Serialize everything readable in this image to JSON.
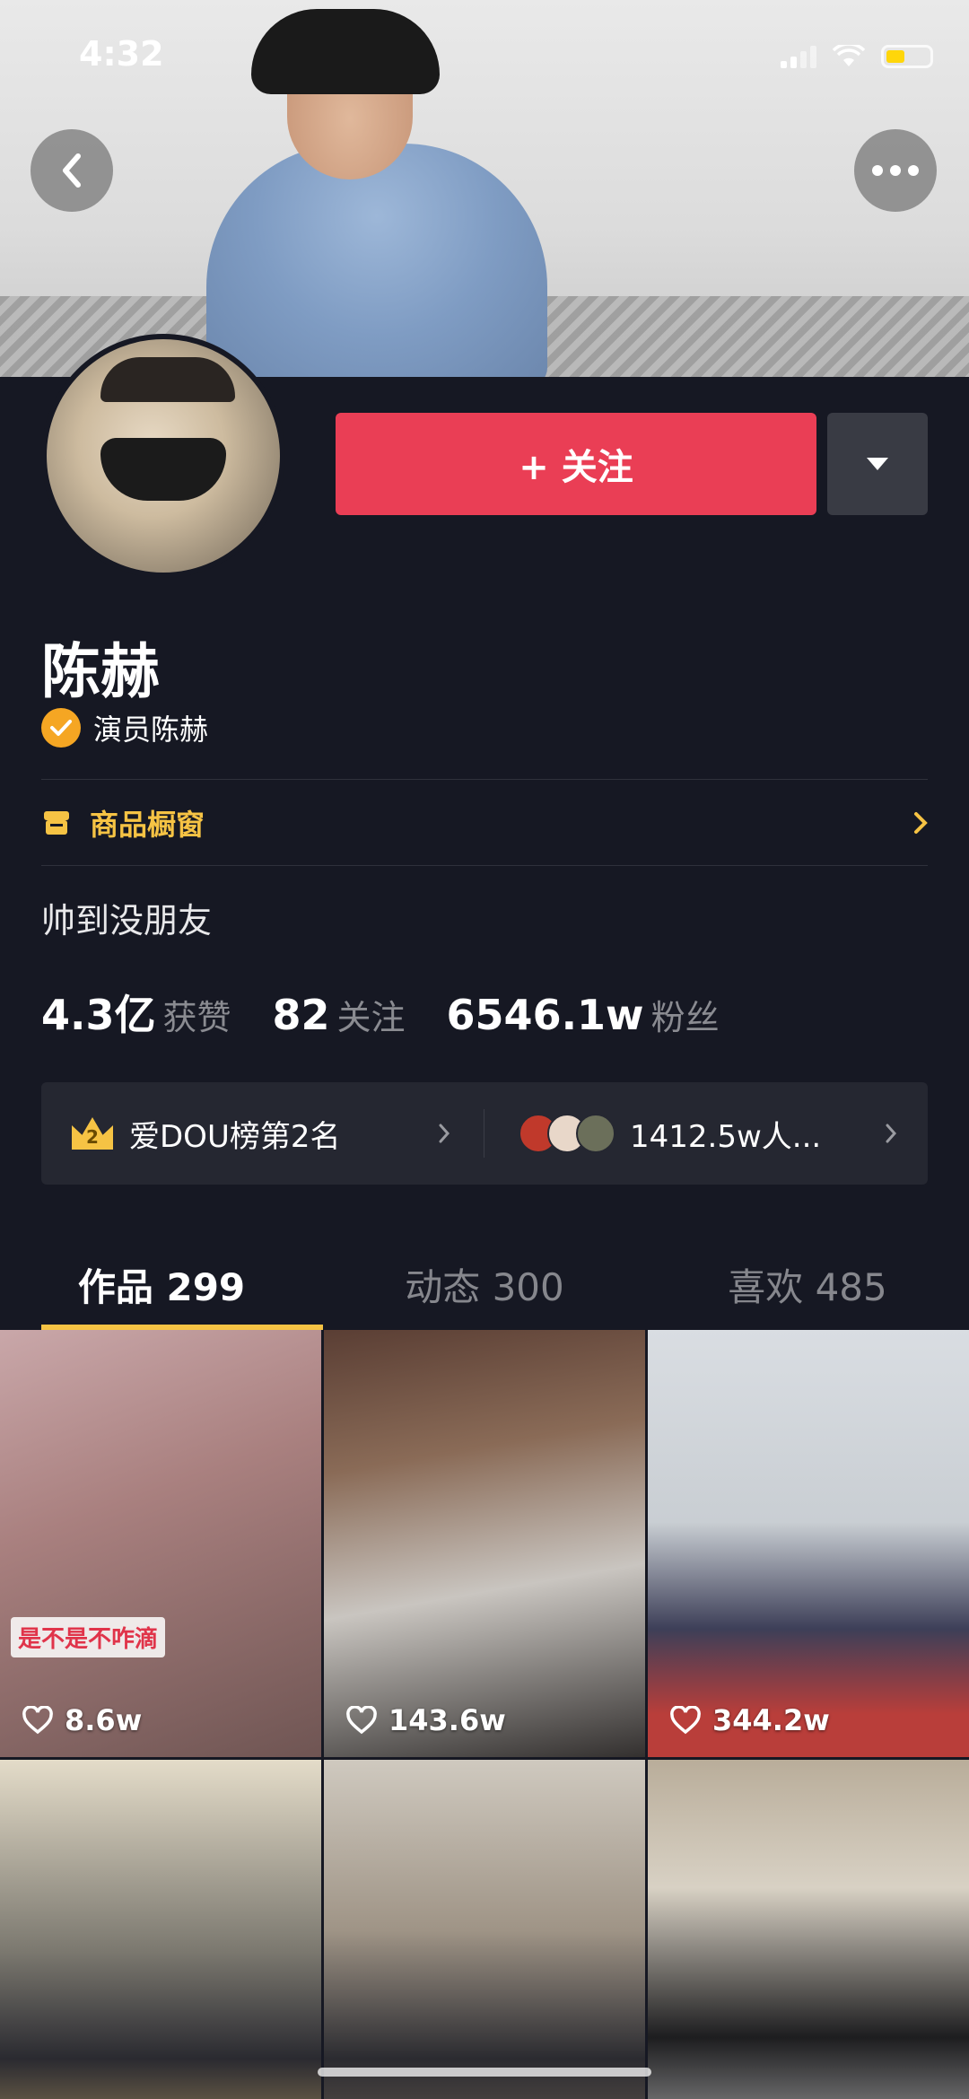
{
  "status_bar": {
    "time": "4:32"
  },
  "profile": {
    "follow_label": "+ 关注",
    "name": "陈赫",
    "verified_title": "演员陈赫",
    "shop_label": "商品橱窗",
    "bio": "帅到没朋友",
    "stats": [
      {
        "value": "4.3亿",
        "label": "获赞"
      },
      {
        "value": "82",
        "label": "关注"
      },
      {
        "value": "6546.1w",
        "label": "粉丝"
      }
    ],
    "rank_label": "爱DOU榜第2名",
    "rank_number": "2",
    "fans_label": "1412.5w人..."
  },
  "tabs": [
    {
      "label": "作品 299"
    },
    {
      "label": "动态 300"
    },
    {
      "label": "喜欢 485"
    }
  ],
  "videos": [
    {
      "likes": "8.6w",
      "caption": "是不是不咋滴"
    },
    {
      "likes": "143.6w"
    },
    {
      "likes": "344.2w"
    },
    {
      "likes": ""
    },
    {
      "likes": ""
    },
    {
      "likes": ""
    }
  ],
  "colors": {
    "accent": "#ea3e55",
    "gold": "#f6c344",
    "background": "#161823"
  }
}
